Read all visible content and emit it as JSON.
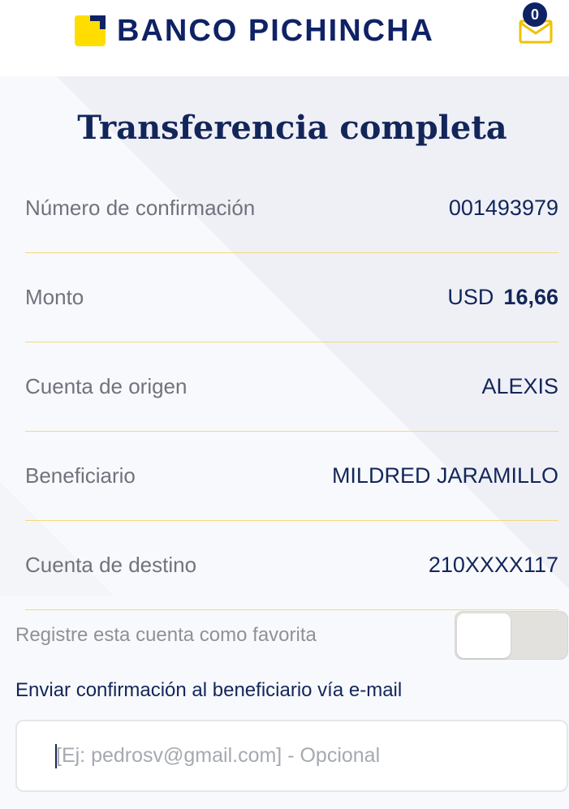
{
  "header": {
    "brand": "BANCO PICHINCHA",
    "logo_icon": "banco-pichincha-logo-icon",
    "mail_icon": "envelope-icon",
    "unread_count": "0"
  },
  "main": {
    "title": "Transferencia completa",
    "rows": [
      {
        "label": "Número de confirmación",
        "value": "001493979"
      },
      {
        "label": "Monto",
        "currency": "USD",
        "amount": "16,66"
      },
      {
        "label": "Cuenta de origen",
        "value": "ALEXIS"
      },
      {
        "label": "Beneficiario",
        "value": "MILDRED JARAMILLO"
      },
      {
        "label": "Cuenta de destino",
        "value": "210XXXX117"
      }
    ],
    "favorite": {
      "label": "Registre esta cuenta como favorita",
      "enabled": false
    },
    "email": {
      "heading": "Enviar confirmación al beneficiario vía e-mail",
      "value": "",
      "placeholder": "[Ej: pedrosv@gmail.com] - Opcional"
    }
  },
  "colors": {
    "brand_navy": "#0f2265",
    "brand_yellow": "#ffdd00",
    "divider_yellow": "#f4d97a",
    "label_gray": "#6f737d",
    "panel_bg": "#f8f9fc",
    "panel_stripe": "#eff0f6"
  }
}
